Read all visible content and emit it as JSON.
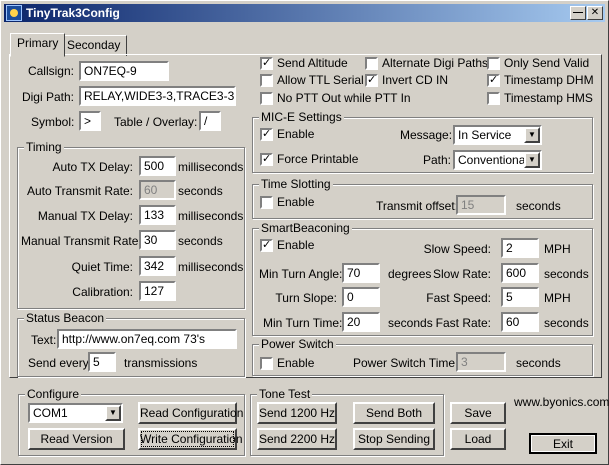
{
  "window": {
    "title": "TinyTrak3Config"
  },
  "tabs": [
    {
      "label": "Primary"
    },
    {
      "label": "Seconday"
    }
  ],
  "station": {
    "callsign_label": "Callsign:",
    "callsign": "ON7EQ-9",
    "digi_label": "Digi Path:",
    "digi_path": "RELAY,WIDE3-3,TRACE3-3",
    "symbol_label": "Symbol:",
    "symbol": ">",
    "table_label": "Table / Overlay:",
    "table": "/"
  },
  "timing": {
    "title": "Timing",
    "auto_tx_delay_label": "Auto TX Delay:",
    "auto_tx_delay": "500",
    "auto_tx_delay_unit": "milliseconds",
    "auto_rate_label": "Auto Transmit Rate:",
    "auto_rate": "60",
    "auto_rate_unit": "seconds",
    "manual_tx_delay_label": "Manual TX Delay:",
    "manual_tx_delay": "133",
    "manual_tx_delay_unit": "milliseconds",
    "manual_rate_label": "Manual Transmit Rate:",
    "manual_rate": "30",
    "manual_rate_unit": "seconds",
    "quiet_label": "Quiet Time:",
    "quiet": "342",
    "quiet_unit": "milliseconds",
    "calibration_label": "Calibration:",
    "calibration": "127"
  },
  "status_beacon": {
    "title": "Status Beacon",
    "text_label": "Text:",
    "text": "http://www.on7eq.com  73's",
    "every_label": "Send every:",
    "every": "5",
    "every_unit": "transmissions"
  },
  "options": {
    "send_altitude": "Send Altitude",
    "alternate_digi": "Alternate Digi Paths",
    "only_send_valid": "Only Send Valid",
    "allow_ttl": "Allow TTL Serial",
    "invert_cd": "Invert CD IN",
    "timestamp_dhm": "Timestamp DHM",
    "no_ptt": "No PTT Out while PTT In",
    "timestamp_hms": "Timestamp HMS"
  },
  "mice": {
    "title": "MIC-E Settings",
    "enable": "Enable",
    "force_printable": "Force Printable",
    "message_label": "Message:",
    "message": "In Service",
    "path_label": "Path:",
    "path": "Conventional"
  },
  "time_slotting": {
    "title": "Time Slotting",
    "enable": "Enable",
    "offset_label": "Transmit offset:",
    "offset": "15",
    "offset_unit": "seconds"
  },
  "smartbeaconing": {
    "title": "SmartBeaconing",
    "enable": "Enable",
    "slow_speed_label": "Slow Speed:",
    "slow_speed": "2",
    "slow_speed_unit": "MPH",
    "min_turn_angle_label": "Min Turn Angle:",
    "min_turn_angle": "70",
    "min_turn_angle_unit": "degrees",
    "slow_rate_label": "Slow Rate:",
    "slow_rate": "600",
    "slow_rate_unit": "seconds",
    "turn_slope_label": "Turn Slope:",
    "turn_slope": "0",
    "fast_speed_label": "Fast Speed:",
    "fast_speed": "5",
    "fast_speed_unit": "MPH",
    "min_turn_time_label": "Min Turn Time:",
    "min_turn_time": "20",
    "min_turn_time_unit": "seconds",
    "fast_rate_label": "Fast Rate:",
    "fast_rate": "60",
    "fast_rate_unit": "seconds"
  },
  "power_switch": {
    "title": "Power Switch",
    "enable": "Enable",
    "time_label": "Power Switch Time:",
    "time": "3",
    "time_unit": "seconds"
  },
  "configure": {
    "title": "Configure",
    "port": "COM1",
    "read_config": "Read Configuration",
    "read_version": "Read Version",
    "write_config": "Write Configuration"
  },
  "tone_test": {
    "title": "Tone Test",
    "send_1200": "Send 1200 Hz",
    "send_both": "Send Both",
    "send_2200": "Send 2200 Hz",
    "stop": "Stop Sending"
  },
  "actions": {
    "save": "Save",
    "load": "Load",
    "exit": "Exit"
  },
  "website": "www.byonics.com"
}
